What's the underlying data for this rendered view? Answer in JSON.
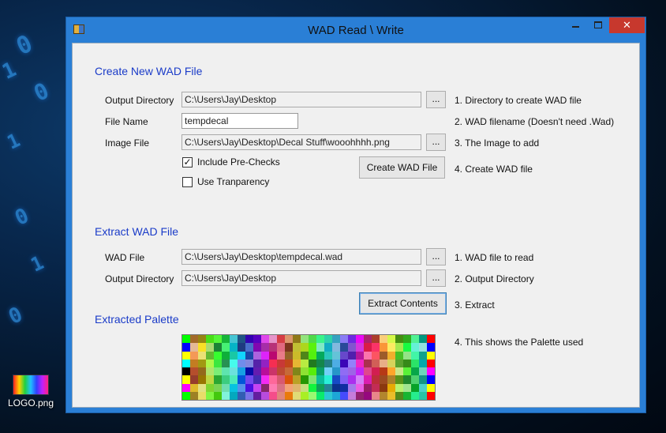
{
  "window": {
    "title": "WAD Read \\ Write",
    "close_glyph": "✕"
  },
  "desktop": {
    "icon_label": "LOGO.png",
    "glyphs": [
      "0",
      "1",
      "0",
      "1",
      "0",
      "1",
      "0"
    ]
  },
  "create": {
    "heading": "Create New WAD File",
    "output_dir_label": "Output Directory",
    "output_dir_value": "C:\\Users\\Jay\\Desktop",
    "file_name_label": "File Name",
    "file_name_value": "tempdecal",
    "image_file_label": "Image File",
    "image_file_value": "C:\\Users\\Jay\\Desktop\\Decal Stuff\\wooohhhh.png",
    "browse_label": "...",
    "include_prechecks_label": "Include Pre-Checks",
    "include_prechecks_checked": true,
    "use_transparency_label": "Use Tranparency",
    "use_transparency_checked": false,
    "create_button": "Create WAD File",
    "hints": [
      "1. Directory to create WAD file",
      "2. WAD filename (Doesn't need .Wad)",
      "3. The Image to add",
      "4. Create WAD file"
    ]
  },
  "extract": {
    "heading": "Extract WAD File",
    "wad_file_label": "WAD File",
    "wad_file_value": "C:\\Users\\Jay\\Desktop\\tempdecal.wad",
    "output_dir_label": "Output Directory",
    "output_dir_value": "C:\\Users\\Jay\\Desktop",
    "browse_label": "...",
    "extract_button": "Extract Contents",
    "hints": [
      "1. WAD file to read",
      "2. Output Directory",
      "3. Extract"
    ]
  },
  "palette": {
    "heading": "Extracted Palette",
    "hint": "4. This shows the Palette used",
    "columns": 32,
    "rows": 8,
    "hue_steps": [
      0,
      30,
      55,
      90,
      120,
      150,
      180,
      210,
      240,
      270,
      300,
      330
    ],
    "accent_colors": [
      "#000000",
      "#ffffff",
      "#ff0000",
      "#00ff00",
      "#0000ff",
      "#ffff00",
      "#ff00ff",
      "#00ffff"
    ]
  },
  "colors": {
    "heading_blue": "#1a3bc8",
    "window_frame": "#2a7fd6",
    "close_red": "#c7382d",
    "client_bg": "#f0f0f0"
  }
}
